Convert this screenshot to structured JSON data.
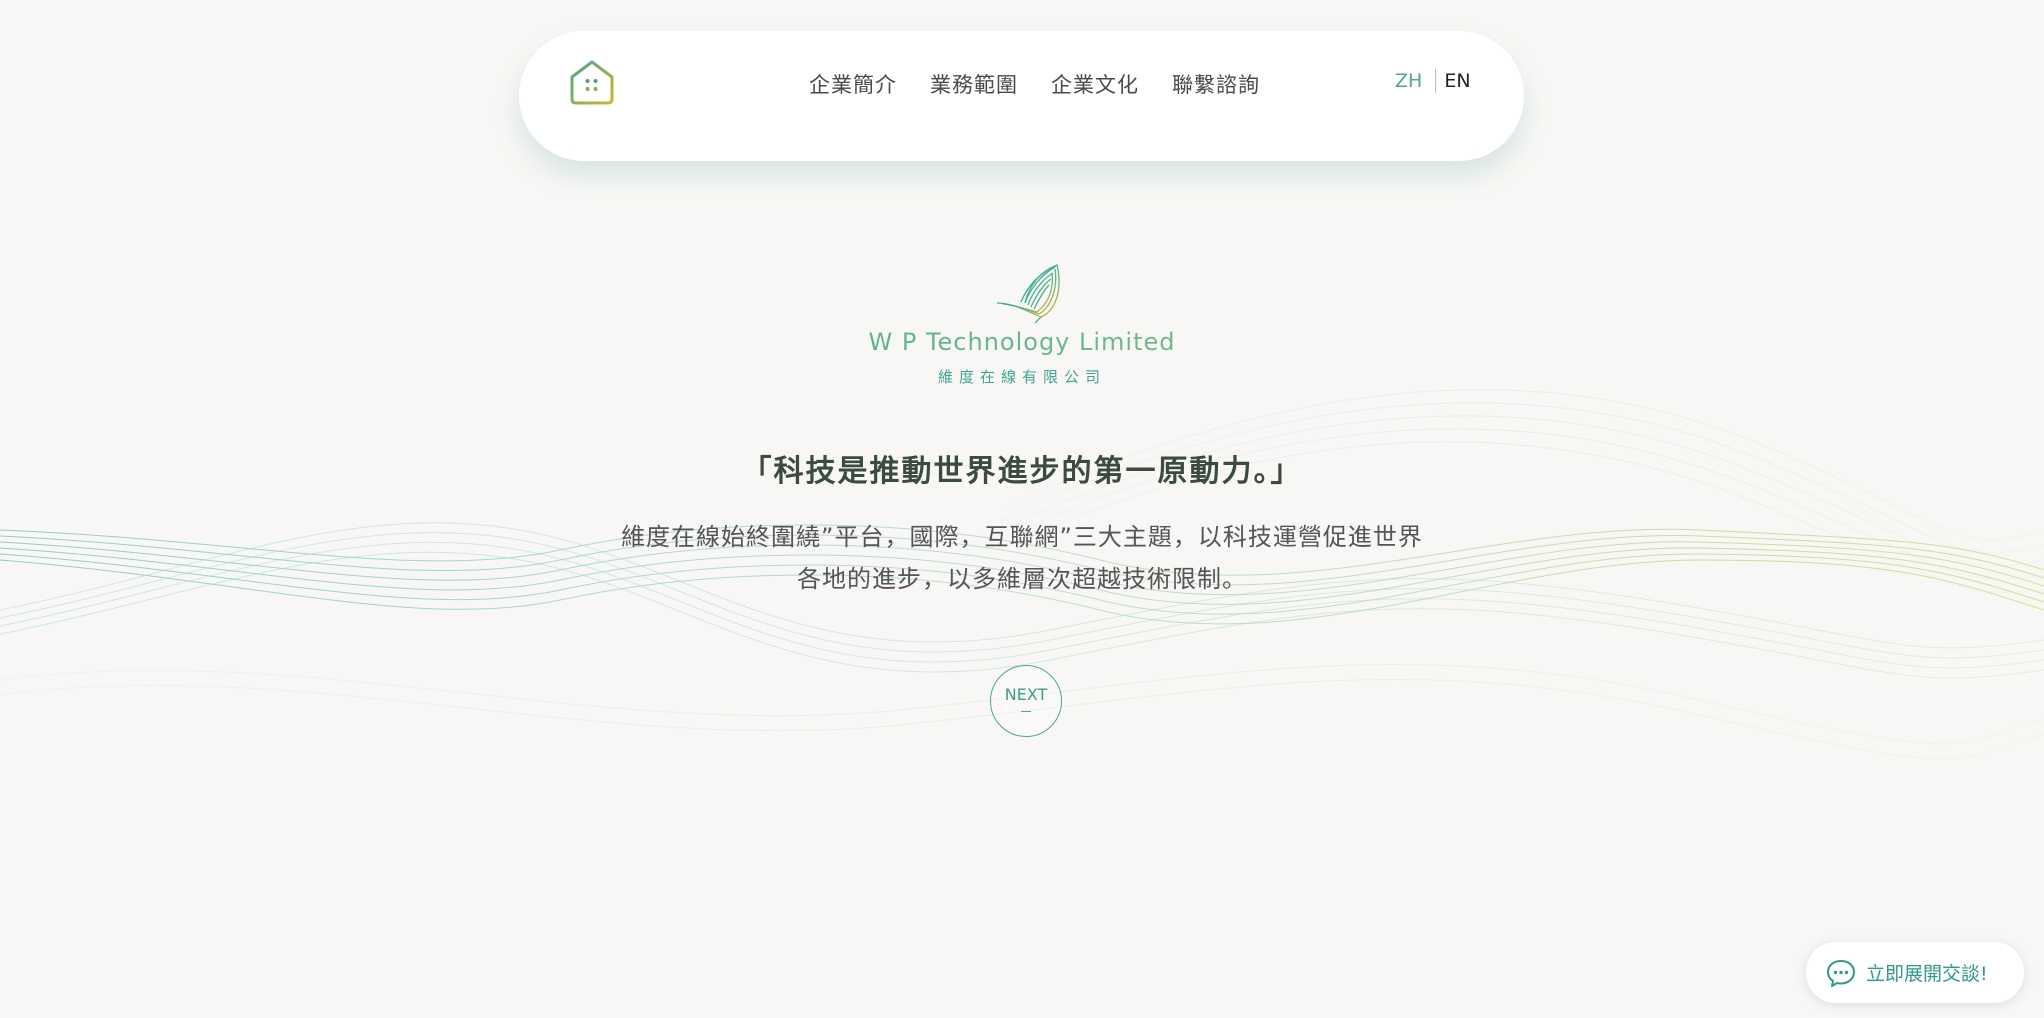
{
  "header": {
    "nav_items": [
      {
        "label": "企業簡介"
      },
      {
        "label": "業務範圍"
      },
      {
        "label": "企業文化"
      },
      {
        "label": "聯繫諮詢"
      }
    ],
    "lang_zh": "ZH",
    "lang_en": "EN",
    "active_lang": "ZH"
  },
  "hero": {
    "logo_name": "W P Technology Limited",
    "logo_sub": "維度在線有限公司",
    "slogan": "「科技是推動世界進步的第一原動力。」",
    "description": "維度在線始終圍繞”平台，國際，互聯網”三大主題，以科技運營促進世界各地的進步，以多維層次超越技術限制。",
    "next_label": "NEXT"
  },
  "chat": {
    "label": "立即展開交談!"
  },
  "colors": {
    "accent_green": "#4ea88a",
    "accent_teal": "#2f9a86",
    "logo_gold": "#c9b230",
    "background": "#f8f7f5"
  },
  "icons": {
    "home": "home-icon",
    "chat": "chat-bubble-icon",
    "logo": "leaf-logo-icon"
  }
}
